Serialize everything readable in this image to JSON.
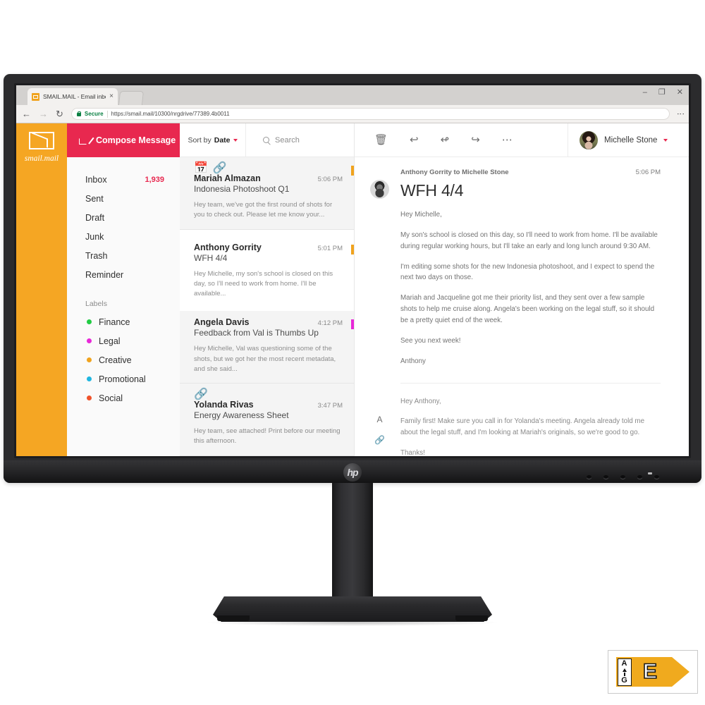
{
  "browser": {
    "tab_title": "SMAIL.MAIL - Email inbo",
    "tab_close": "×",
    "back_icon": "←",
    "forward_icon": "→",
    "reload_icon": "↻",
    "secure_label": "Secure",
    "url": "https://smail.mail/10300/nrgdrive/77389.4b0011",
    "minimize": "–",
    "maximize": "❐",
    "close": "✕",
    "menu": "⋮"
  },
  "rail": {
    "brand": "smail.mail"
  },
  "nav": {
    "compose_label": "Compose Message",
    "items": [
      {
        "label": "Inbox",
        "count": "1,939"
      },
      {
        "label": "Sent",
        "count": ""
      },
      {
        "label": "Draft",
        "count": ""
      },
      {
        "label": "Junk",
        "count": ""
      },
      {
        "label": "Trash",
        "count": ""
      },
      {
        "label": "Reminder",
        "count": ""
      }
    ],
    "labels_heading": "Labels",
    "labels": [
      {
        "label": "Finance",
        "color": "#22cc44"
      },
      {
        "label": "Legal",
        "color": "#e828d8"
      },
      {
        "label": "Creative",
        "color": "#f0a31e"
      },
      {
        "label": "Promotional",
        "color": "#1fb6e0"
      },
      {
        "label": "Social",
        "color": "#f0522a"
      }
    ]
  },
  "list_header": {
    "sort_prefix": "Sort by",
    "sort_value": "Date",
    "search_placeholder": "Search"
  },
  "mails": [
    {
      "from": "Mariah Almazan",
      "time": "5:06 PM",
      "subject": "Indonesia Photoshoot Q1",
      "preview": "Hey team, we've got the first round of shots for you to check out. Please let me know your...",
      "tag_color": "#f0a31e",
      "has_calendar": true,
      "has_attachment": true,
      "active": false
    },
    {
      "from": "Anthony Gorrity",
      "time": "5:01 PM",
      "subject": "WFH 4/4",
      "preview": "Hey Michelle, my son's school is closed on this day, so I'll need to work from home. I'll be available...",
      "tag_color": "#f0a31e",
      "has_calendar": false,
      "has_attachment": false,
      "active": true
    },
    {
      "from": "Angela Davis",
      "time": "4:12 PM",
      "subject": "Feedback from Val is Thumbs Up",
      "preview": "Hey Michelle, Val was questioning some of the shots, but we got her the most recent metadata, and she said...",
      "tag_color": "#e828d8",
      "has_calendar": false,
      "has_attachment": false,
      "active": false
    },
    {
      "from": "Yolanda Rivas",
      "time": "3:47 PM",
      "subject": "Energy Awareness Sheet",
      "preview": "Hey team, see attached! Print before our meeting this afternoon.",
      "tag_color": "",
      "has_calendar": false,
      "has_attachment": true,
      "active": false
    }
  ],
  "toolbar": {
    "delete_icon": "Ὕ1",
    "reply_icon": "↩",
    "reply_all_icon": "↫",
    "forward_icon": "↪",
    "more_icon": "• • •",
    "user_name": "Michelle Stone"
  },
  "message": {
    "meta": "Anthony Gorrity to Michelle Stone",
    "time": "5:06 PM",
    "subject": "WFH 4/4",
    "paragraphs": [
      "Hey Michelle,",
      "My son's school is closed on this day, so I'll need to work from home. I'll be available during regular working hours, but I'll take an early and long lunch around 9:30 AM.",
      "I'm editing some shots for the new Indonesia photoshoot, and I expect to spend the next two days on those.",
      "Mariah and Jacqueline got me their priority list, and they sent over a few sample shots to help me cruise along. Angela's been working on the legal stuff, so it should be a pretty quiet end of the week.",
      "See you next week!",
      "Anthony"
    ]
  },
  "reply": {
    "format_icon": "A",
    "attach_icon": "🔗",
    "paragraphs": [
      "Hey Anthony,",
      "Family first! Make sure you call in for Yolanda's meeting. Angela already told me about the legal stuff, and I'm looking at Mariah's originals, so we're good to go.",
      "Thanks!"
    ]
  },
  "monitor": {
    "brand": "hp"
  },
  "energy_label": {
    "scale_top": "A",
    "scale_bottom": "G",
    "grade": "E"
  }
}
